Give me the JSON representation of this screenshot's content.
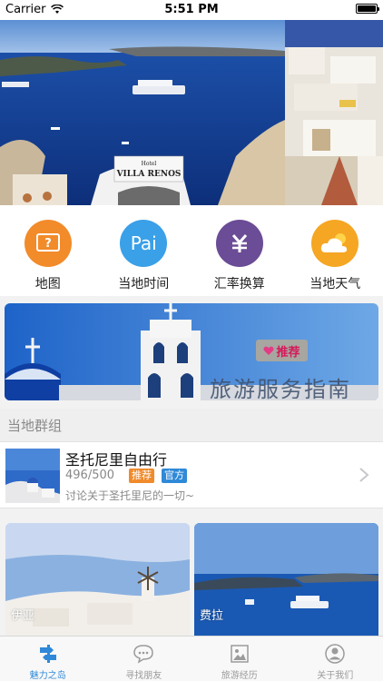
{
  "status_bar": {
    "carrier": "Carrier",
    "time": "5:51 PM",
    "battery_level": 1.0
  },
  "hero": {
    "main_slide_icon": "santorini-harbor-photo",
    "next_slide_icon": "santorini-village-photo",
    "sign_text": "VILLA RENOS",
    "sign_small": "Hotel"
  },
  "quick_menu": [
    {
      "label": "地图",
      "icon": "map-icon",
      "icon_text": "?",
      "color": "#f28b2a"
    },
    {
      "label": "当地时间",
      "icon": "clock-icon",
      "icon_text": "Pai",
      "color": "#3aa0e8"
    },
    {
      "label": "汇率换算",
      "icon": "currency-yuan-icon",
      "icon_text": "¥",
      "color": "#6b4c96"
    },
    {
      "label": "当地天气",
      "icon": "weather-icon",
      "icon_text": "",
      "color": "#f5a623"
    }
  ],
  "banner": {
    "tag": "推荐",
    "tag_icon": "heart-icon",
    "title": "旅游服务指南"
  },
  "section": {
    "title": "当地群组"
  },
  "group": {
    "name": "圣托尼里自由行",
    "count": "496/500",
    "badge_recommend": "推荐",
    "badge_official": "官方",
    "description": "讨论关于圣托里尼的一切~"
  },
  "photos": [
    {
      "label": "伊亚",
      "icon": "oia-photo"
    },
    {
      "label": "费拉",
      "icon": "fira-photo"
    }
  ],
  "tabs": [
    {
      "label": "魅力之岛",
      "icon": "signpost-icon",
      "active": true
    },
    {
      "label": "寻找朋友",
      "icon": "chat-bubble-icon",
      "active": false
    },
    {
      "label": "旅游经历",
      "icon": "photo-icon",
      "active": false
    },
    {
      "label": "关于我们",
      "icon": "user-icon",
      "active": false
    }
  ],
  "colors": {
    "accent": "#2f89d8",
    "badge_recommend": "#f08a2a",
    "badge_official": "#2f89d8"
  }
}
